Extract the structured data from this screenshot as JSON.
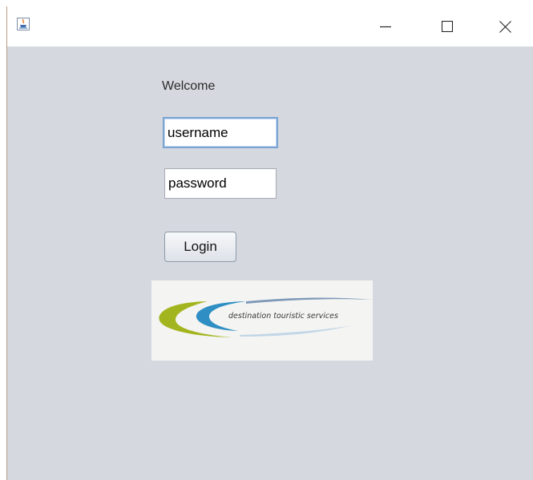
{
  "window": {
    "title": "",
    "controls": {
      "minimize": "minimize-icon",
      "maximize": "maximize-icon",
      "close": "close-icon"
    }
  },
  "form": {
    "welcome_label": "Welcome",
    "username_value": "username",
    "password_value": "password",
    "login_label": "Login"
  },
  "logo": {
    "text": "destination touristic services",
    "colors": {
      "green": "#a3b51e",
      "blue": "#2f8fc4",
      "navy": "#1f4f8a"
    }
  },
  "colors": {
    "window_bg": "#d5d8df",
    "titlebar_bg": "#ffffff",
    "focus_border": "#7aa4d4"
  }
}
